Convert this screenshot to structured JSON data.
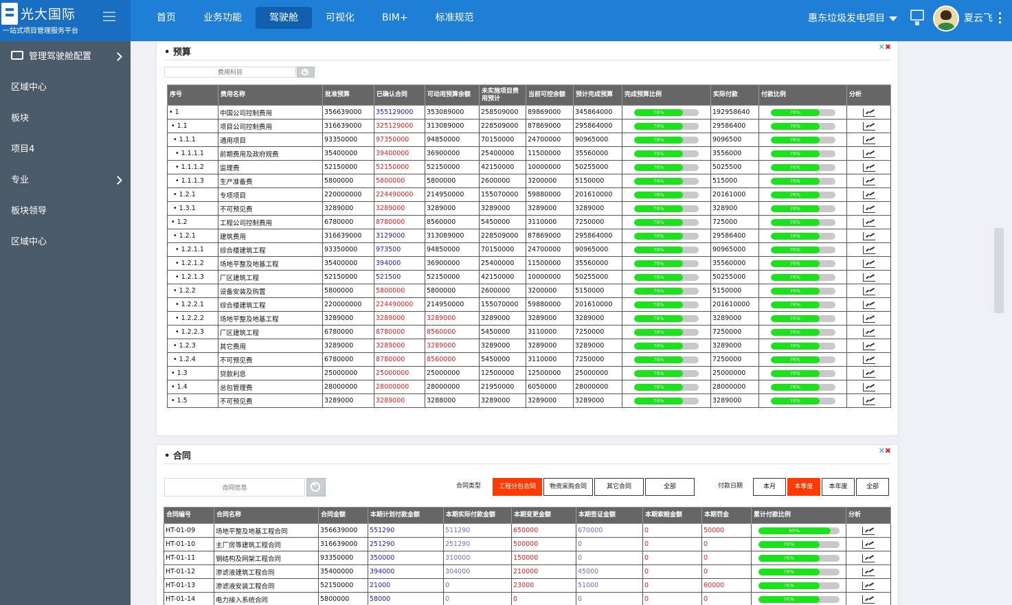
{
  "app": {
    "name": "光大国际",
    "subtitle": "一站式项目管理服务平台"
  },
  "nav": {
    "items": [
      "首页",
      "业务功能",
      "驾驶舱",
      "可视化",
      "BIM+",
      "标准规范"
    ],
    "active": 2
  },
  "header": {
    "project": "惠东垃圾发电项目",
    "user": "夏云飞"
  },
  "sidebar": {
    "items": [
      {
        "label": "管理驾驶舱配置",
        "icon": "folder-icon",
        "arrow": true
      },
      {
        "label": "区域中心",
        "arrow": false
      },
      {
        "label": "板块",
        "arrow": false
      },
      {
        "label": "项目4",
        "arrow": false
      },
      {
        "label": "专业",
        "arrow": true
      },
      {
        "label": "板块领导",
        "arrow": false
      },
      {
        "label": "区域中心",
        "arrow": false
      }
    ]
  },
  "colors": {
    "accent": "#1f7fd6",
    "sidebar": "#4b5a69",
    "active_filter": "#ff3a00",
    "progress": "#1be31b"
  },
  "budget": {
    "title": "• 预算",
    "search_placeholder": "费用科目",
    "columns": [
      "序号",
      "费用名称",
      "批准预算",
      "已确认合同",
      "可动用预算余额",
      "未实施项目费用预计",
      "当前可控余额",
      "预计完成预算",
      "完成预算比例",
      "实际付款",
      "付款比例",
      "分析"
    ],
    "rows": [
      [
        "• 1",
        "中国公司控制费用",
        "356639000",
        "355129000",
        "353089000",
        "258509000",
        "89869000",
        "345864000",
        "76%",
        "192958640",
        "76%"
      ],
      [
        "• 1.1",
        "项目公司控制费用",
        "316639000",
        "325129000",
        "313089000",
        "228509000",
        "87869000",
        "295864000",
        "76%",
        "29586400",
        "76%"
      ],
      [
        "• 1.1.1",
        "通用项目",
        "93350000",
        "97350000",
        "94850000",
        "70150000",
        "24700000",
        "90965000",
        "76%",
        "9096500",
        "76%"
      ],
      [
        "• 1.1.1.1",
        "前期费用及政府规费",
        "35400000",
        "39400000",
        "36900000",
        "25400000",
        "11500000",
        "35560000",
        "76%",
        "3556000",
        "76%"
      ],
      [
        "• 1.1.1.2",
        "监理费",
        "52150000",
        "52150000",
        "52150000",
        "42150000",
        "10000000",
        "50255000",
        "76%",
        "5025500",
        "76%"
      ],
      [
        "• 1.1.1.3",
        "生产准备费",
        "5800000",
        "5800000",
        "5800000",
        "2600000",
        "3200000",
        "5150000",
        "76%",
        "515000",
        "76%"
      ],
      [
        "• 1.2.1",
        "专项项目",
        "220000000",
        "224490000",
        "214950000",
        "155070000",
        "59880000",
        "201610000",
        "76%",
        "20161000",
        "76%"
      ],
      [
        "• 1.3.1",
        "不可预见费",
        "3289000",
        "3289000",
        "3289000",
        "3289000",
        "3289000",
        "3289000",
        "76%",
        "328900",
        "76%"
      ],
      [
        "• 1.2",
        "工程公司控制费用",
        "6780000",
        "8780000",
        "8560000",
        "5450000",
        "3110000",
        "7250000",
        "76%",
        "725000",
        "76%"
      ],
      [
        "• 1.2.1",
        "建筑费用",
        "316639000",
        "3129000",
        "313089000",
        "228509000",
        "87869000",
        "295864000",
        "76%",
        "29586400",
        "76%"
      ],
      [
        "• 1.2.1.1",
        "综合楼建筑工程",
        "93350000",
        "973500",
        "94850000",
        "70150000",
        "24700000",
        "90965000",
        "76%",
        "90965000",
        "76%"
      ],
      [
        "• 1.2.1.2",
        "场地平整及地基工程",
        "35400000",
        "394000",
        "36900000",
        "25400000",
        "11500000",
        "35560000",
        "76%",
        "35560000",
        "76%"
      ],
      [
        "• 1.2.1.3",
        "厂区建筑工程",
        "52150000",
        "521500",
        "52150000",
        "42150000",
        "10000000",
        "50255000",
        "76%",
        "50255000",
        "76%"
      ],
      [
        "• 1.2.2",
        "设备安装及购置",
        "5800000",
        "5800000",
        "5800000",
        "2600000",
        "3200000",
        "5150000",
        "76%",
        "5150000",
        "76%"
      ],
      [
        "• 1.2.2.1",
        "综合楼建筑工程",
        "220000000",
        "224490000",
        "214950000",
        "155070000",
        "59880000",
        "201610000",
        "76%",
        "201610000",
        "76%"
      ],
      [
        "• 1.2.2.2",
        "场地平整及地基工程",
        "3289000",
        "3289000",
        "3289000",
        "3289000",
        "3289000",
        "3289000",
        "76%",
        "3289000",
        "76%"
      ],
      [
        "• 1.2.2.3",
        "厂区建筑工程",
        "6780000",
        "8780000",
        "8560000",
        "5450000",
        "3110000",
        "7250000",
        "76%",
        "7250000",
        "76%"
      ],
      [
        "• 1.2.3",
        "其它费用",
        "3289000",
        "3289000",
        "3289000",
        "3289000",
        "3289000",
        "3289000",
        "76%",
        "3289000",
        "76%"
      ],
      [
        "• 1.2.4",
        "不可预见费",
        "6780000",
        "8780000",
        "8560000",
        "5450000",
        "3110000",
        "7250000",
        "76%",
        "7250000",
        "76%"
      ],
      [
        "• 1.3",
        "贷款利息",
        "25000000",
        "25000000",
        "25000000",
        "12500000",
        "12500000",
        "25000000",
        "76%",
        "25000000",
        "76%"
      ],
      [
        "• 1.4",
        "总包管理费",
        "28000000",
        "28000000",
        "28000000",
        "21950000",
        "6050000",
        "28000000",
        "76%",
        "28000000",
        "76%"
      ],
      [
        "• 1.5",
        "不可预见费",
        "3289000",
        "3289000",
        "3288000",
        "3289000",
        "3289000",
        "3289000",
        "76%",
        "3289000",
        "76%"
      ]
    ]
  },
  "contract": {
    "title": "• 合同",
    "search_placeholder": "合同信息",
    "type_label": "合同类型",
    "type_options": [
      "工程分包合同",
      "物资采购合同",
      "其它合同",
      "全部"
    ],
    "type_active": 0,
    "date_label": "付款日期",
    "date_options": [
      "本月",
      "本季度",
      "本年度",
      "全部"
    ],
    "date_active": 1,
    "columns": [
      "合同编号",
      "合同名称",
      "合同金额",
      "本期计划付款金额",
      "本期实际付款金额",
      "本期变更金额",
      "本期签证金额",
      "本期索赔金额",
      "本期罚金",
      "累计付款比例",
      "分析"
    ],
    "rows": [
      [
        "HT-01-09",
        "场地平整及地基工程合同",
        "356639000",
        "551290",
        "511290",
        "650000",
        "670000",
        "0",
        "50000",
        "89%"
      ],
      [
        "HT-01-10",
        "主厂房等建筑工程合同",
        "316639000",
        "251290",
        "251290",
        "500000",
        "0",
        "0",
        "0",
        "76%"
      ],
      [
        "HT-01-11",
        "钢结构及网架工程合同",
        "93350000",
        "350000",
        "310000",
        "150000",
        "0",
        "0",
        "0",
        "76%"
      ],
      [
        "HT-01-12",
        "渗滤液建筑工程合同",
        "35400000",
        "394000",
        "304000",
        "210000",
        "45000",
        "0",
        "0",
        "76%"
      ],
      [
        "HT-01-13",
        "渗滤液安装工程合同",
        "52150000",
        "21000",
        "0",
        "23000",
        "51000",
        "0",
        "60000",
        "76%"
      ],
      [
        "HT-01-14",
        "电力接入系统合同",
        "5800000",
        "58000",
        "0",
        "0",
        "0",
        "0",
        "0",
        "76%"
      ]
    ]
  }
}
